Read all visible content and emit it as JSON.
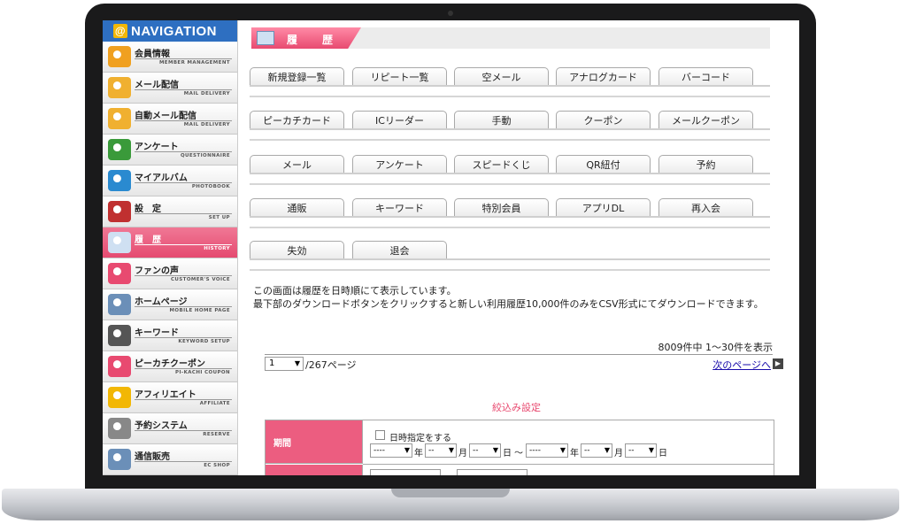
{
  "sidebar": {
    "header": "NAVIGATION",
    "items": [
      {
        "label": "会員情報",
        "sub": "MEMBER MANAGEMENT",
        "icon": "members-icon"
      },
      {
        "label": "メール配信",
        "sub": "MAIL DELIVERY",
        "icon": "mail-icon"
      },
      {
        "label": "自動メール配信",
        "sub": "MAIL DELIVERY",
        "icon": "auto-mail-icon"
      },
      {
        "label": "アンケート",
        "sub": "QUESTIONNAIRE",
        "icon": "pie-chart-icon"
      },
      {
        "label": "マイアルバム",
        "sub": "PHOTOBOOK",
        "icon": "album-icon"
      },
      {
        "label": "設　定",
        "sub": "SET UP",
        "icon": "tools-icon"
      },
      {
        "label": "履　歴",
        "sub": "HISTORY",
        "icon": "history-icon",
        "active": true
      },
      {
        "label": "ファンの声",
        "sub": "CUSTOMER'S VOICE",
        "icon": "heart-icon"
      },
      {
        "label": "ホームページ",
        "sub": "MOBILE HOME PAGE",
        "icon": "mobile-icon"
      },
      {
        "label": "キーワード",
        "sub": "KEYWORD SETUP",
        "icon": "pencil-icon"
      },
      {
        "label": "ピーカチクーポン",
        "sub": "PI-KACHI COUPON",
        "icon": "gift-icon"
      },
      {
        "label": "アフィリエイト",
        "sub": "AFFILIATE",
        "icon": "coin-icon"
      },
      {
        "label": "予約システム",
        "sub": "RESERVE",
        "icon": "clock-icon"
      },
      {
        "label": "通信販売",
        "sub": "EC SHOP",
        "icon": "cart-icon"
      }
    ]
  },
  "page": {
    "title": "履　歴"
  },
  "tabs": [
    [
      "新規登録一覧",
      "リピート一覧",
      "空メール",
      "アナログカード",
      "バーコード"
    ],
    [
      "ピーカチカード",
      "ICリーダー",
      "手動",
      "クーポン",
      "メールクーポン"
    ],
    [
      "メール",
      "アンケート",
      "スピードくじ",
      "QR紐付",
      "予約"
    ],
    [
      "通販",
      "キーワード",
      "特別会員",
      "アプリDL",
      "再入会"
    ],
    [
      "失効",
      "退会"
    ]
  ],
  "description": {
    "line1": "この画面は履歴を日時順にて表示しています。",
    "line2": "最下部のダウンロードボタンをクリックすると新しい利用履歴10,000件のみをCSV形式にてダウンロードできます。"
  },
  "pager": {
    "count_text": "8009件中 1～30件を表示",
    "page_value": "1",
    "page_total": "/267ページ",
    "next_label": "次のページへ"
  },
  "filter": {
    "title": "絞込み設定",
    "period_label": "期間",
    "datetime_checkbox_label": "日時指定をする",
    "from_year": "----",
    "from_month": "--",
    "from_day": "--",
    "to_year": "----",
    "to_month": "--",
    "to_day": "--",
    "unit_year": "年",
    "unit_month": "月",
    "unit_day": "日",
    "range_sep": "～"
  },
  "colors": {
    "accent_pink": "#e84a70",
    "nav_blue": "#2e6fc1"
  }
}
